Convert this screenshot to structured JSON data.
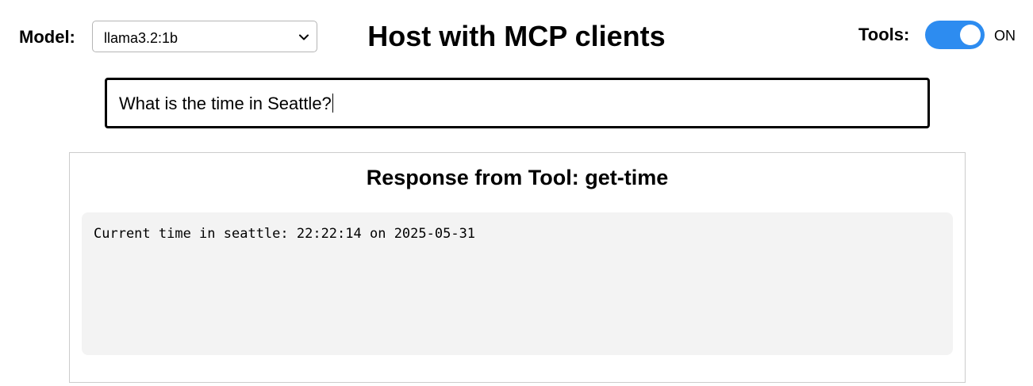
{
  "header": {
    "model_label": "Model:",
    "model_selected": "llama3.2:1b",
    "title": "Host with MCP clients",
    "tools_label": "Tools:",
    "tools_state": "ON",
    "tools_enabled": true
  },
  "query": {
    "value": "What is the time in Seattle?"
  },
  "response": {
    "title": "Response from Tool: get-time",
    "text": "Current time in seattle: 22:22:14 on 2025-05-31"
  },
  "icons": {
    "model_dropdown": "chevron-down-icon"
  },
  "colors": {
    "toggle_on": "#2d8cf0",
    "response_background": "#f3f3f3"
  }
}
